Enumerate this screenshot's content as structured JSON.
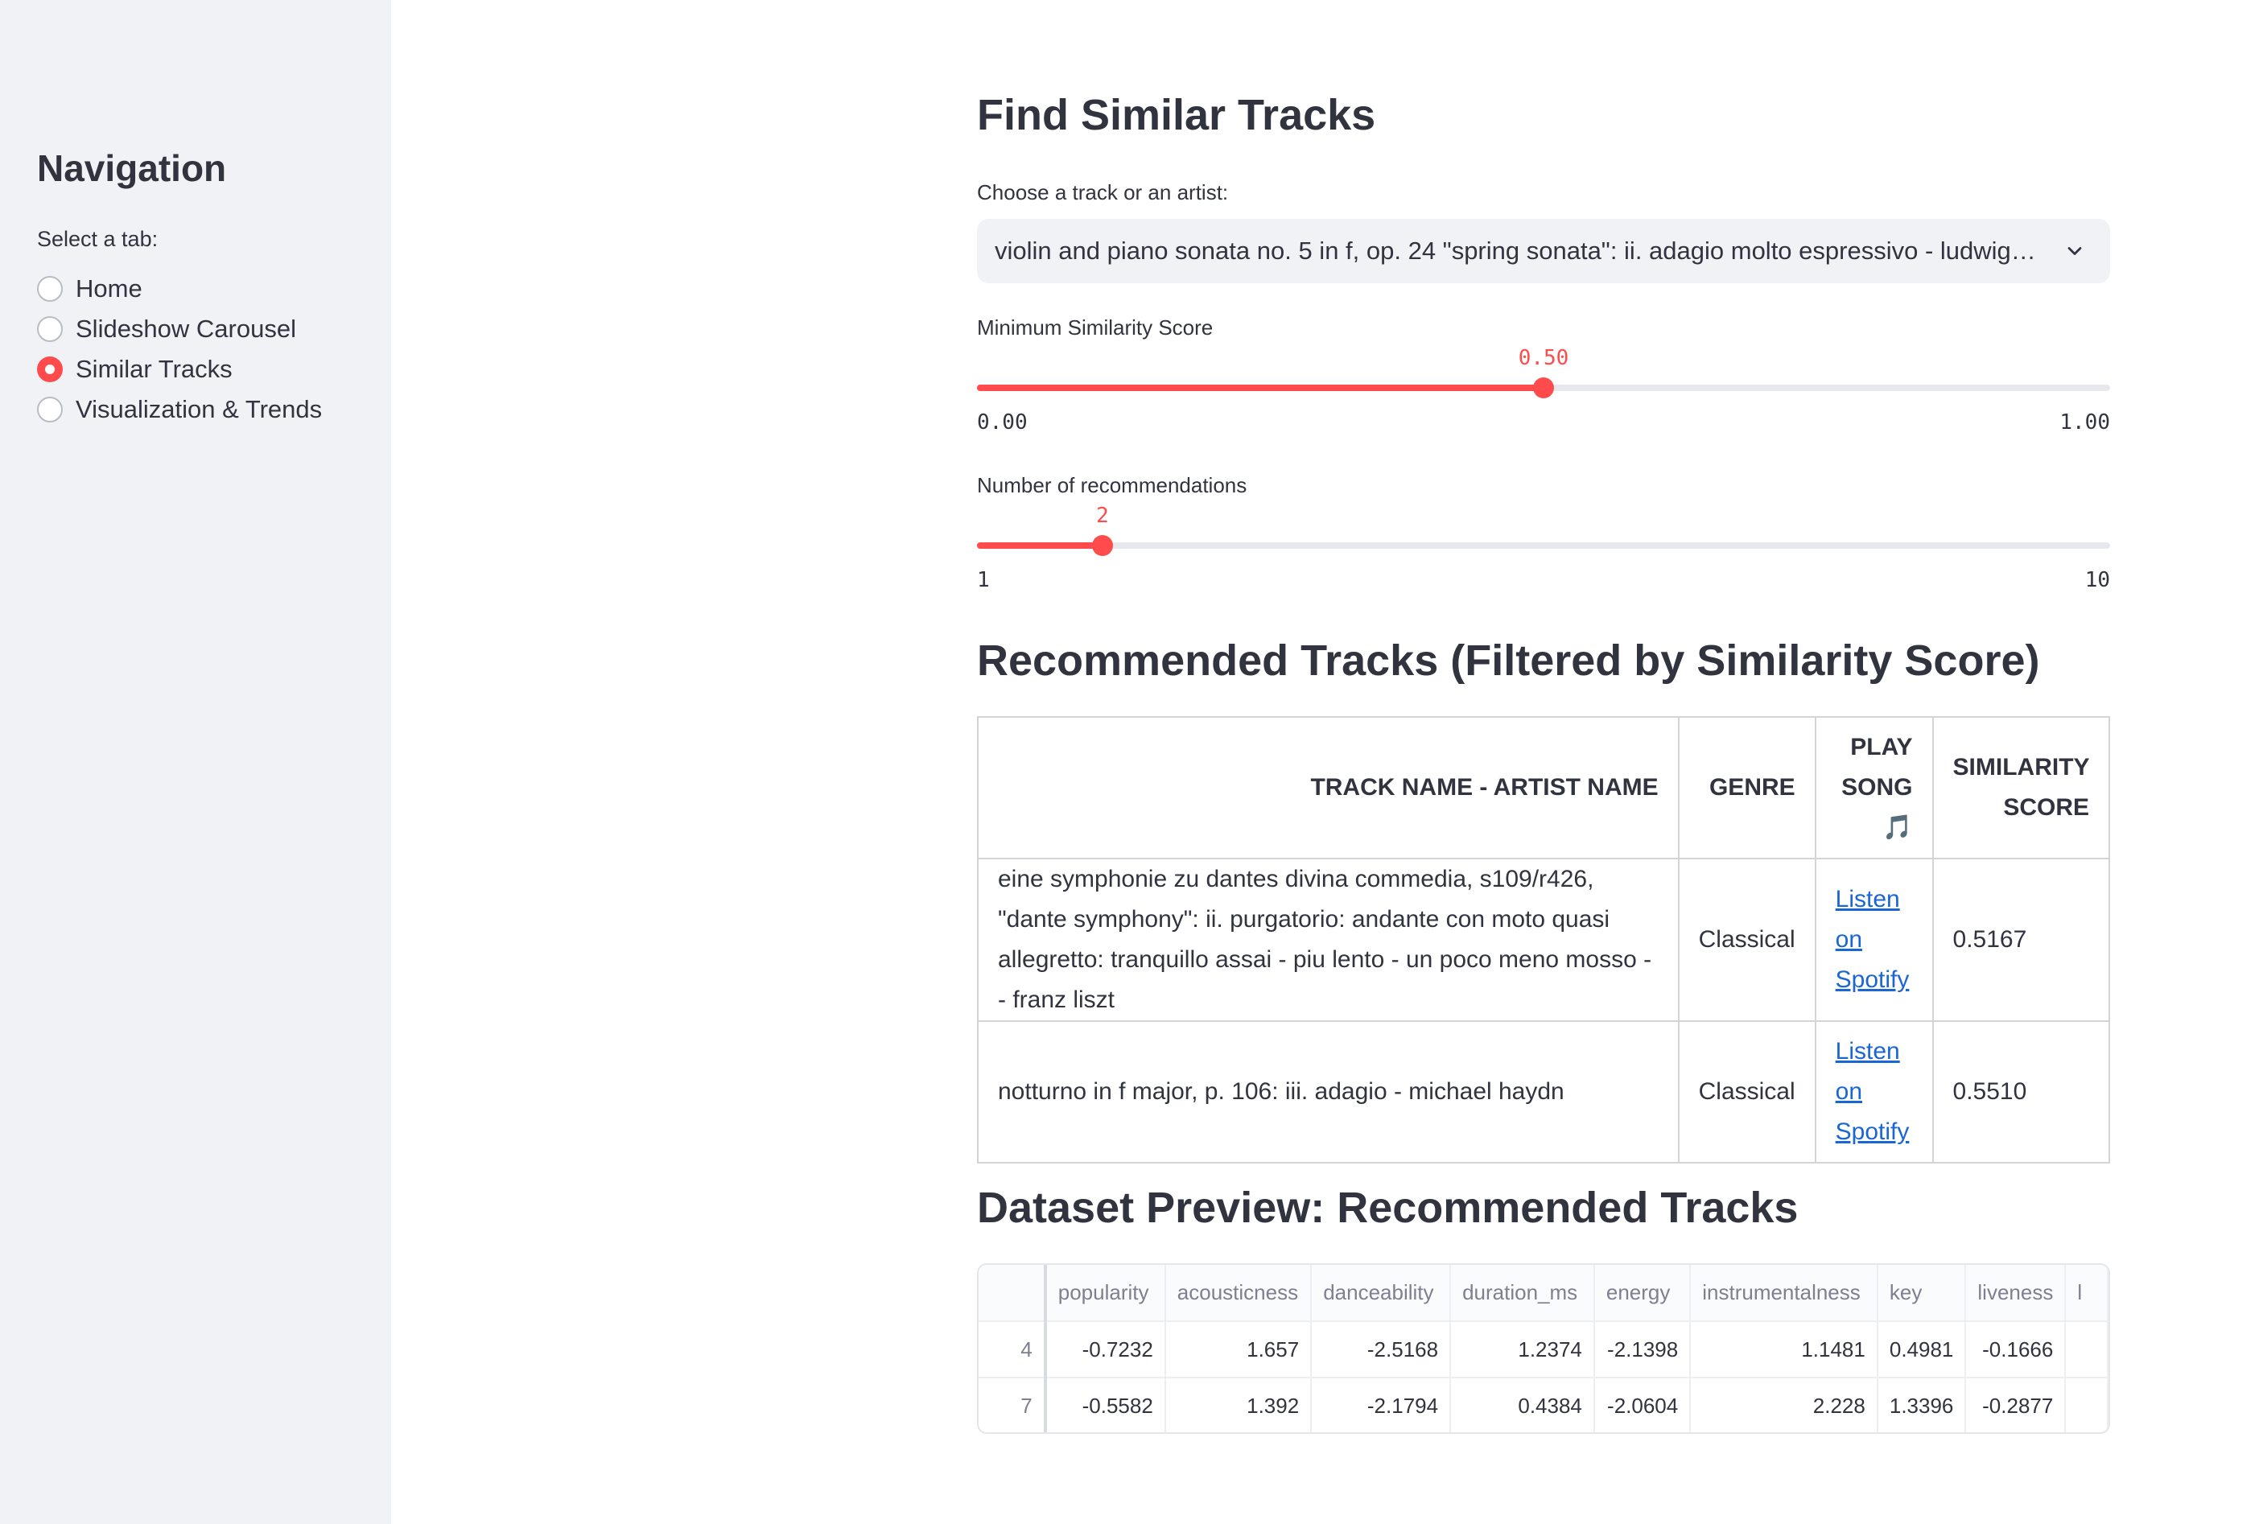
{
  "sidebar": {
    "title": "Navigation",
    "radio_label": "Select a tab:",
    "options": [
      {
        "label": "Home",
        "checked": false
      },
      {
        "label": "Slideshow Carousel",
        "checked": false
      },
      {
        "label": "Similar Tracks",
        "checked": true
      },
      {
        "label": "Visualization & Trends",
        "checked": false
      }
    ]
  },
  "main": {
    "title": "Find Similar Tracks",
    "select": {
      "label": "Choose a track or an artist:",
      "value": "violin and piano sonata no. 5 in f, op. 24 \"spring sonata\": ii. adagio molto espressivo - ludwig van beethoven",
      "icon": "chevron-down-icon"
    },
    "similarity_slider": {
      "label": "Minimum Similarity Score",
      "value": "0.50",
      "min": "0.00",
      "max": "1.00",
      "fraction": 0.5
    },
    "count_slider": {
      "label": "Number of recommendations",
      "value": "2",
      "min": "1",
      "max": "10",
      "fraction": 0.1111
    },
    "rec_title": "Recommended Tracks (Filtered by Similarity Score)",
    "rec_table": {
      "headers": [
        "Track Name - Artist Name",
        "Genre",
        "Play Song 🎵",
        "Similarity Score"
      ],
      "rows": [
        {
          "track": "eine symphonie zu dantes divina commedia, s109/r426, \"dante symphony\": ii. purgatorio: andante con moto quasi allegretto: tranquillo assai - piu lento - un poco meno mosso - - franz liszt",
          "genre": "Classical",
          "link": "Listen on Spotify",
          "score": "0.5167"
        },
        {
          "track": "notturno in f major, p. 106: iii. adagio - michael haydn",
          "genre": "Classical",
          "link": "Listen on Spotify",
          "score": "0.5510"
        }
      ]
    },
    "preview_title": "Dataset Preview: Recommended Tracks",
    "preview": {
      "columns": [
        "",
        "popularity",
        "acousticness",
        "danceability",
        "duration_ms",
        "energy",
        "instrumentalness",
        "key",
        "liveness",
        "l"
      ],
      "rows": [
        [
          "4",
          "-0.7232",
          "1.657",
          "-2.5168",
          "1.2374",
          "-2.1398",
          "1.1481",
          "0.4981",
          "-0.1666",
          ""
        ],
        [
          "7",
          "-0.5582",
          "1.392",
          "-2.1794",
          "0.4384",
          "-2.0604",
          "2.228",
          "1.3396",
          "-0.2877",
          ""
        ]
      ]
    }
  }
}
